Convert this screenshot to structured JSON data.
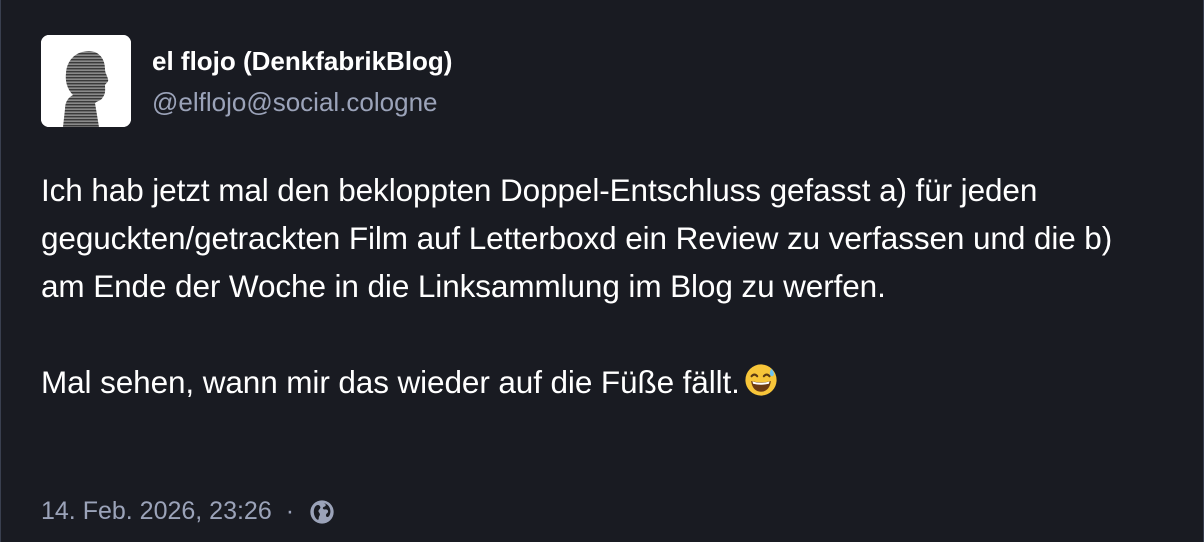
{
  "post": {
    "author": {
      "display_name": "el flojo (DenkfabrikBlog)",
      "handle": "@elflojo@social.cologne",
      "avatar_icon": "silhouette-avatar"
    },
    "content": {
      "paragraph_1": "Ich hab jetzt mal den bekloppten Doppel-Entschluss gefasst a) für jeden geguckten/getrackten Film auf Letterboxd ein Review zu verfassen und die b) am Ende der Woche in die Linksammlung im Blog zu werfen.",
      "paragraph_2": "Mal sehen, wann mir das wieder auf die Füße fällt.",
      "emoji": "sweat-smile-emoji"
    },
    "meta": {
      "timestamp": "14. Feb. 2026, 23:26",
      "separator": "·",
      "visibility_icon": "globe-icon"
    }
  },
  "colors": {
    "background": "#191b22",
    "text": "#ffffff",
    "secondary_text": "#9ba3b9",
    "border": "#393f4f"
  }
}
